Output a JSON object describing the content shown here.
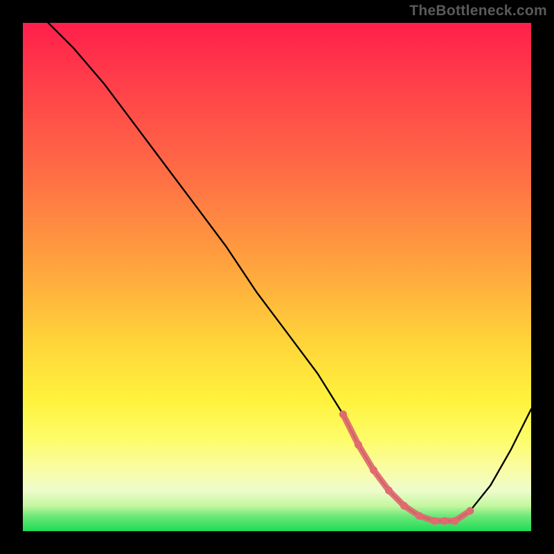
{
  "watermark": "TheBottleneck.com",
  "chart_data": {
    "type": "line",
    "title": "",
    "xlabel": "",
    "ylabel": "",
    "xlim": [
      0,
      100
    ],
    "ylim": [
      0,
      100
    ],
    "series": [
      {
        "name": "curve",
        "x": [
          5,
          10,
          16,
          22,
          28,
          34,
          40,
          46,
          52,
          58,
          63,
          66,
          69,
          72,
          75,
          78,
          81,
          83,
          85,
          88,
          92,
          96,
          100
        ],
        "y": [
          100,
          95,
          88,
          80,
          72,
          64,
          56,
          47,
          39,
          31,
          23,
          17,
          12,
          8,
          5,
          3,
          2,
          2,
          2,
          4,
          9,
          16,
          24
        ]
      }
    ],
    "highlight_segment": {
      "note": "pink dotted emphasis near valley bottom",
      "x": [
        63,
        66,
        69,
        72,
        75,
        78,
        81,
        83,
        85,
        88
      ],
      "y": [
        23,
        17,
        12,
        8,
        5,
        3,
        2,
        2,
        2,
        4
      ]
    },
    "colors": {
      "curve": "#000000",
      "highlight": "#e06a6f",
      "gradient_top": "#ff1f4b",
      "gradient_mid": "#fff23c",
      "gradient_bottom": "#1fdb57",
      "frame": "#000000"
    }
  }
}
